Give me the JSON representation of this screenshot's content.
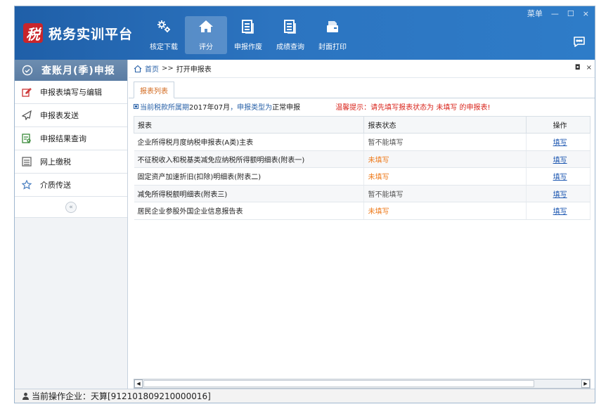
{
  "app": {
    "logo_char": "税",
    "title": "税务实训平台"
  },
  "toolbar": {
    "items": [
      {
        "label": "核定下载",
        "icon": "gear-download-icon"
      },
      {
        "label": "评分",
        "icon": "home-icon",
        "active": true
      },
      {
        "label": "申报作废",
        "icon": "document-icon"
      },
      {
        "label": "成绩查询",
        "icon": "document-icon"
      },
      {
        "label": "封面打印",
        "icon": "folder-print-icon"
      }
    ]
  },
  "window_controls": {
    "menu_label": "菜单",
    "minimize": "—",
    "restore": "☐",
    "close": "×"
  },
  "sidebar": {
    "title": "查账月(季)申报",
    "items": [
      {
        "label": "申报表填写与编辑",
        "icon": "edit-icon"
      },
      {
        "label": "申报表发送",
        "icon": "send-icon"
      },
      {
        "label": "申报结果查询",
        "icon": "search-result-icon"
      },
      {
        "label": "网上缴税",
        "icon": "list-icon"
      },
      {
        "label": "介质传送",
        "icon": "star-icon"
      }
    ],
    "collapse_symbol": "«"
  },
  "breadcrumb": {
    "home": "首页",
    "separator": ">>",
    "current": "打开申报表"
  },
  "panel_controls": {
    "restore": "◘",
    "close": "×"
  },
  "tab": {
    "label": "报表列表"
  },
  "info": {
    "prefix": "当前税款所属期",
    "period": "2017年07月",
    "mid": "，申报类型为",
    "type": "正常申报",
    "warning": "温馨提示：请先填写报表状态为 未填写 的申报表!"
  },
  "table": {
    "headers": {
      "report": "报表",
      "status": "报表状态",
      "op": "操作"
    },
    "rows": [
      {
        "report": "企业所得税月度纳税申报表(A类)主表",
        "status": "暂不能填写",
        "status_kind": "gray",
        "op": "填写"
      },
      {
        "report": "不征税收入和税基类减免应纳税所得额明细表(附表一)",
        "status": "未填写",
        "status_kind": "orange",
        "op": "填写"
      },
      {
        "report": "固定资产加速折旧(扣除)明细表(附表二)",
        "status": "未填写",
        "status_kind": "orange",
        "op": "填写"
      },
      {
        "report": "减免所得税额明细表(附表三)",
        "status": "暂不能填写",
        "status_kind": "gray",
        "op": "填写"
      },
      {
        "report": "居民企业参股外国企业信息报告表",
        "status": "未填写",
        "status_kind": "orange",
        "op": "填写"
      }
    ]
  },
  "statusbar": {
    "text": "当前操作企业：天算[912101809210000016]"
  },
  "colors": {
    "header_blue": "#2c74c0",
    "logo_red": "#c9252b",
    "warning_red": "#d9251c",
    "status_orange": "#ee7a1b",
    "link_blue": "#1a55b0"
  }
}
